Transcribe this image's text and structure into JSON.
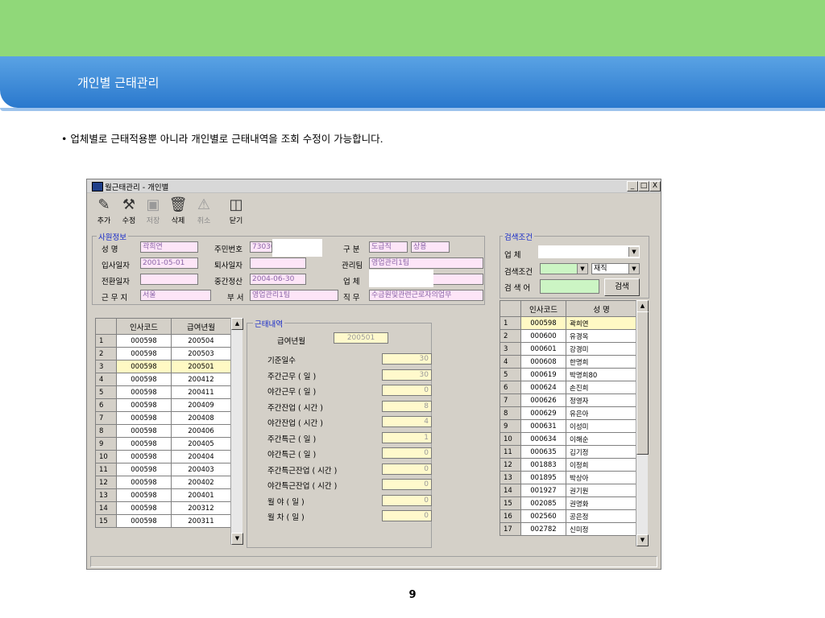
{
  "slide": {
    "title": "개인별 근태관리",
    "bullet_mark": "•",
    "bullet_text": "업체별로 근태적용뿐 아니라 개인별로 근태내역을 조회 수정이 가능합니다.",
    "page_number": "9"
  },
  "window": {
    "title": "월근태관리 - 개인별",
    "controls": [
      "_",
      "□",
      "X"
    ]
  },
  "toolbar": {
    "add": "추가",
    "edit": "수정",
    "save": "저장",
    "delete": "삭제",
    "cancel": "취소",
    "close": "닫기"
  },
  "employee_info": {
    "group_title": "사원정보",
    "name_label": "성    명",
    "name_value": "곽희연",
    "resident_no_label": "주민번호",
    "resident_no_value": "73030",
    "category_label": "구  분",
    "category_value": "도급직",
    "category_value2": "상용",
    "hire_date_label": "입사일자",
    "hire_date_value": "2001-05-01",
    "resign_date_label": "퇴사일자",
    "resign_date_value": "",
    "team_label": "관리팀",
    "team_value": "영업관리1팀",
    "transfer_date_label": "전환일자",
    "transfer_date_value": "",
    "interim_label": "중간정산",
    "interim_value": "2004-06-30",
    "company_label": "업  체",
    "company_value": "",
    "workplace_label": "근 무 지",
    "workplace_value": "서울",
    "dept_label": "부  서",
    "dept_value": "영업관리1팀",
    "duty_label": "직  무",
    "duty_value": "수금원및관련근로자의업무"
  },
  "search": {
    "group_title": "검색조건",
    "company_label": "업    체",
    "company_value": "",
    "condition_label": "검색조건",
    "condition_value": "",
    "status_value": "재직",
    "keyword_label": "검 색 어",
    "keyword_value": "",
    "search_button": "검색"
  },
  "month_grid": {
    "headers": [
      "",
      "인사코드",
      "급여년월"
    ],
    "rows": [
      [
        "1",
        "000598",
        "200504"
      ],
      [
        "2",
        "000598",
        "200503"
      ],
      [
        "3",
        "000598",
        "200501"
      ],
      [
        "4",
        "000598",
        "200412"
      ],
      [
        "5",
        "000598",
        "200411"
      ],
      [
        "6",
        "000598",
        "200409"
      ],
      [
        "7",
        "000598",
        "200408"
      ],
      [
        "8",
        "000598",
        "200406"
      ],
      [
        "9",
        "000598",
        "200405"
      ],
      [
        "10",
        "000598",
        "200404"
      ],
      [
        "11",
        "000598",
        "200403"
      ],
      [
        "12",
        "000598",
        "200402"
      ],
      [
        "13",
        "000598",
        "200401"
      ],
      [
        "14",
        "000598",
        "200312"
      ],
      [
        "15",
        "000598",
        "200311"
      ]
    ],
    "selected_row": 3
  },
  "attendance": {
    "group_title": "근태내역",
    "pay_month_label": "급여년월",
    "pay_month_value": "200501",
    "items": [
      {
        "label": "기준일수",
        "value": "30"
      },
      {
        "label": "주간근무 ( 일 )",
        "value": "30"
      },
      {
        "label": "야간근무 ( 일 )",
        "value": "0"
      },
      {
        "label": "주간잔업 ( 시간 )",
        "value": "8"
      },
      {
        "label": "야간잔업 ( 시간 )",
        "value": "4"
      },
      {
        "label": "주간특근 ( 일 )",
        "value": "1"
      },
      {
        "label": "야간특근 ( 일 )",
        "value": "0"
      },
      {
        "label": "주간특근잔업 ( 시간 )",
        "value": "0"
      },
      {
        "label": "야간특근잔업 ( 시간 )",
        "value": "0"
      },
      {
        "label": "월    야 ( 일 )",
        "value": "0"
      },
      {
        "label": "월  차 ( 일 )",
        "value": "0"
      }
    ]
  },
  "employee_grid": {
    "headers": [
      "",
      "인사코드",
      "성 명"
    ],
    "rows": [
      [
        "1",
        "000598",
        "곽희연"
      ],
      [
        "2",
        "000600",
        "유경옥"
      ],
      [
        "3",
        "000601",
        "강경미"
      ],
      [
        "4",
        "000608",
        "한명희"
      ],
      [
        "5",
        "000619",
        "박명희80"
      ],
      [
        "6",
        "000624",
        "손진희"
      ],
      [
        "7",
        "000626",
        "정영자"
      ],
      [
        "8",
        "000629",
        "유은아"
      ],
      [
        "9",
        "000631",
        "이성미"
      ],
      [
        "10",
        "000634",
        "이해순"
      ],
      [
        "11",
        "000635",
        "김기정"
      ],
      [
        "12",
        "001883",
        "이정희"
      ],
      [
        "13",
        "001895",
        "박상아"
      ],
      [
        "14",
        "001927",
        "권기원"
      ],
      [
        "15",
        "002085",
        "권명화"
      ],
      [
        "16",
        "002560",
        "공은정"
      ],
      [
        "17",
        "002782",
        "신미정"
      ]
    ],
    "selected_row": 1
  },
  "colors": {
    "band_green": "#90d879",
    "title_blue": "#2a78cd",
    "field_pink": "#fde5f7",
    "field_yellow": "#fff9cc",
    "field_green": "#ccf5c4",
    "group_title": "#1428c8"
  }
}
